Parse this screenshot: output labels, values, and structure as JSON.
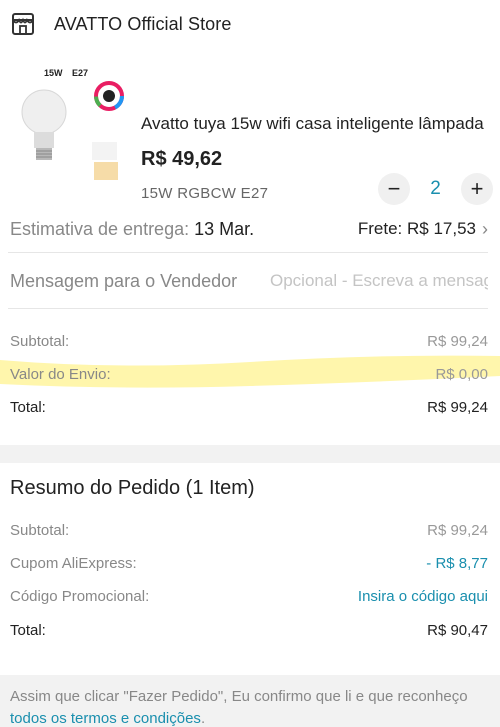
{
  "store": {
    "name": "AVATTO Official Store",
    "icon": "store-icon"
  },
  "product": {
    "image_labels": [
      "15W",
      "E27"
    ],
    "title": "Avatto tuya 15w wifi casa inteligente lâmpada",
    "price": "R$ 49,62",
    "variant": "15W RGBCW E27",
    "quantity": "2",
    "decrement": "−",
    "increment": "+"
  },
  "delivery": {
    "label": "Estimativa de entrega: ",
    "date": "13 Mar.",
    "shipping": "Frete: R$ 17,53"
  },
  "message": {
    "label": "Mensagem para o Vendedor",
    "placeholder": "Opcional - Escreva a mensagem"
  },
  "store_totals": {
    "subtotal_label": "Subtotal:",
    "subtotal_value": "R$ 99,24",
    "shipping_label": "Valor do Envio:",
    "shipping_value": "R$ 0,00",
    "total_label": "Total:",
    "total_value": "R$ 99,24"
  },
  "order_summary": {
    "title": "Resumo do Pedido (1 Item)",
    "subtotal_label": "Subtotal:",
    "subtotal_value": "R$ 99,24",
    "coupon_label": "Cupom AliExpress:",
    "coupon_value": "- R$ 8,77",
    "promo_label": "Código Promocional:",
    "promo_link": "Insira o código aqui",
    "total_label": "Total:",
    "total_value": "R$ 90,47"
  },
  "terms": {
    "text": "Assim que clicar \"Fazer Pedido\", Eu confirmo que li e que reconheço ",
    "link": "todos os termos e condições",
    "end": "."
  },
  "colors": {
    "accent": "#1a8fae",
    "highlight": "#fff59d"
  }
}
